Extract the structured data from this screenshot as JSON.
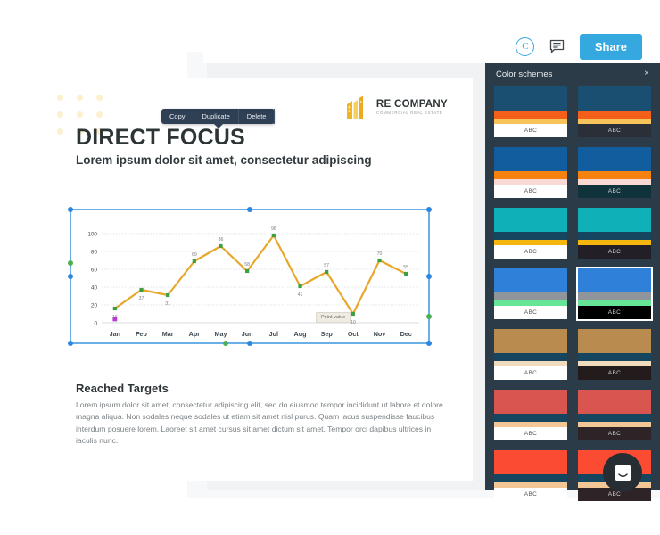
{
  "toolbar": {
    "avatar_initial": "C",
    "comment_icon": "comment-icon",
    "share_label": "Share"
  },
  "context_menu": {
    "items": [
      {
        "label": "Copy"
      },
      {
        "label": "Duplicate"
      },
      {
        "label": "Delete"
      }
    ]
  },
  "slide": {
    "logo": {
      "name": "RE COMPANY",
      "sub": "COMMERCIAL REAL ESTATE"
    },
    "title": "DIRECT FOCUS",
    "subtitle": "Lorem ipsum dolor sit amet, consectetur adipiscing",
    "body_heading": "Reached Targets",
    "body_text": "Lorem ipsum dolor sit amet, consectetur adipiscing elit, sed do eiusmod tempor incididunt ut labore et dolore magna aliqua. Non sodales neque sodales ut etiam sit amet nisl purus. Quam lacus suspendisse faucibus interdum posuere lorem. Laoreet sit amet cursus sit amet dictum sit amet. Tempor orci dapibus ultrices in iaculis nunc.",
    "tooltip": "Point value"
  },
  "panel": {
    "title": "Color schemes",
    "close_label": "×",
    "swatch_caption": "ABC",
    "schemes": [
      {
        "name": "aspect-light",
        "a": "#1b4f72",
        "b": "#f4601a",
        "c": "#f7c45c",
        "bg": "#ffffff",
        "text": "#555555",
        "selected": false
      },
      {
        "name": "aspect-dark",
        "a": "#1b4f72",
        "b": "#f4601a",
        "c": "#f7c45c",
        "bg": "#2b2f38",
        "text": "#cfd3d8",
        "selected": false
      },
      {
        "name": "civic-light",
        "a": "#115d9e",
        "b": "#f5820f",
        "c": "#f9d9d4",
        "bg": "#ffffff",
        "text": "#555555",
        "selected": false
      },
      {
        "name": "civic-dark",
        "a": "#115d9e",
        "b": "#f5820f",
        "c": "#f9d9d4",
        "bg": "#10323a",
        "text": "#cfd3d8",
        "selected": false
      },
      {
        "name": "equity-light",
        "a": "#10b0b8",
        "b": "#15455f",
        "c": "#f5b70d",
        "bg": "#ffffff",
        "text": "#555555",
        "selected": false
      },
      {
        "name": "equity-dark",
        "a": "#10b0b8",
        "b": "#15455f",
        "c": "#f5b70d",
        "bg": "#221f26",
        "text": "#cfd3d8",
        "selected": false
      },
      {
        "name": "flow-light",
        "a": "#2f80d8",
        "b": "#8f959b",
        "c": "#66e596",
        "bg": "#ffffff",
        "text": "#555555",
        "selected": false
      },
      {
        "name": "flow-dark",
        "a": "#2f80d8",
        "b": "#8f959b",
        "c": "#66e596",
        "bg": "#000000",
        "text": "#cfd3d8",
        "selected": true
      },
      {
        "name": "foundry-light",
        "a": "#b98b4f",
        "b": "#15455f",
        "c": "#f0dcbc",
        "bg": "#ffffff",
        "text": "#555555",
        "selected": false
      },
      {
        "name": "foundry-dark",
        "a": "#b98b4f",
        "b": "#15455f",
        "c": "#f0dcbc",
        "bg": "#241c1c",
        "text": "#cfd3d8",
        "selected": false
      },
      {
        "name": "median-light",
        "a": "#d85550",
        "b": "#15455f",
        "c": "#f3c795",
        "bg": "#ffffff",
        "text": "#555555",
        "selected": false
      },
      {
        "name": "median-dark",
        "a": "#d85550",
        "b": "#15455f",
        "c": "#f3c795",
        "bg": "#2e2326",
        "text": "#cfd3d8",
        "selected": false
      },
      {
        "name": "metro-light",
        "a": "#fb4b32",
        "b": "#15455f",
        "c": "#f3c795",
        "bg": "#ffffff",
        "text": "#555555",
        "selected": false
      },
      {
        "name": "metro-dark",
        "a": "#fb4b32",
        "b": "#15455f",
        "c": "#f3c795",
        "bg": "#2e2326",
        "text": "#cfd3d8",
        "selected": false
      }
    ]
  },
  "chat": {
    "icon": "chat-smiley-icon"
  },
  "chart_data": {
    "type": "line",
    "title": "",
    "xlabel": "",
    "ylabel": "",
    "categories": [
      "Jan",
      "Feb",
      "Mar",
      "Apr",
      "May",
      "Jun",
      "Jul",
      "Aug",
      "Sep",
      "Oct",
      "Nov",
      "Dec"
    ],
    "values": [
      16,
      37,
      31,
      69,
      86,
      58,
      98,
      41,
      57,
      10,
      70,
      55
    ],
    "data_labels": [
      "16",
      "37",
      "31",
      "69",
      "86",
      "58",
      "98",
      "41",
      "57",
      "10",
      "70",
      "55"
    ],
    "yticks": [
      0,
      20,
      40,
      60,
      80,
      100
    ],
    "ylim": [
      0,
      110
    ],
    "grid": true,
    "legend": "none",
    "line_color": "#e8a72a",
    "marker_color": "#3f9e3f",
    "label_color": "#7d7d7d",
    "axis_color": "#3f4b52",
    "secondary_point": {
      "category": "Jan",
      "value": 4,
      "color": "#b43fd0"
    }
  }
}
